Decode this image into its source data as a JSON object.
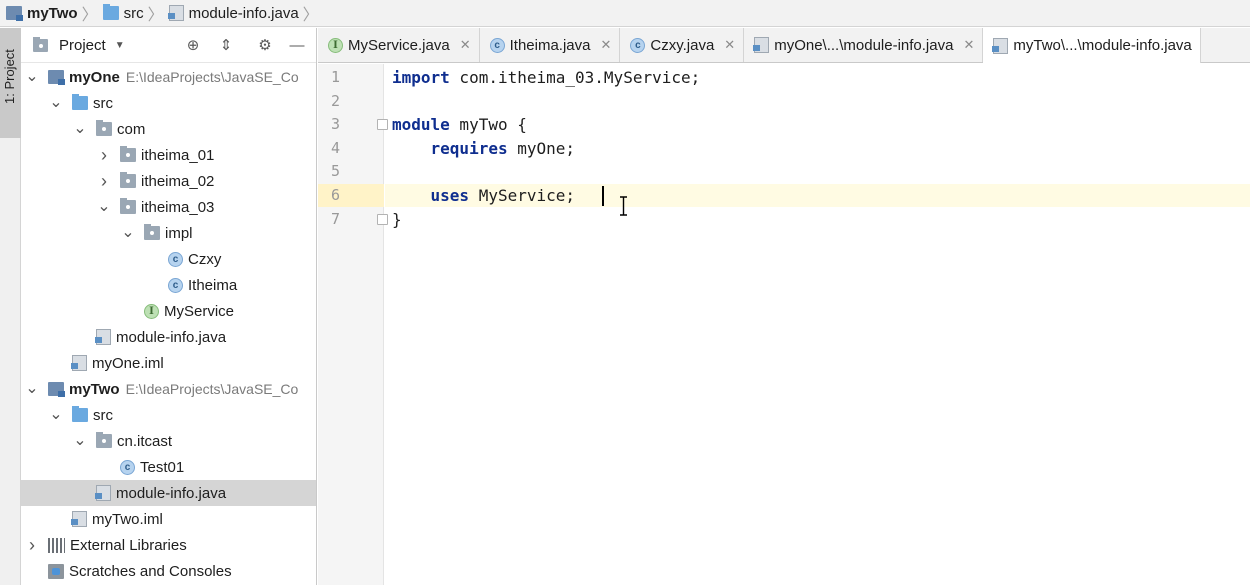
{
  "breadcrumb": {
    "items": [
      {
        "label": "myTwo",
        "icon": "module-icon"
      },
      {
        "label": "src",
        "icon": "folder-icon"
      },
      {
        "label": "module-info.java",
        "icon": "java-file-icon"
      }
    ]
  },
  "tool_stripe": {
    "project_tab_label": "1: Project"
  },
  "project_panel": {
    "title": "Project",
    "tree": [
      {
        "label": "myOne",
        "path": "E:\\IdeaProjects\\JavaSE_Co",
        "icon": "module",
        "bold": true,
        "expanded": true,
        "indent": 0
      },
      {
        "label": "src",
        "icon": "src",
        "expanded": true,
        "indent": 1
      },
      {
        "label": "com",
        "icon": "pkg",
        "expanded": true,
        "indent": 2
      },
      {
        "label": "itheima_01",
        "icon": "pkg",
        "expanded": false,
        "indent": 3
      },
      {
        "label": "itheima_02",
        "icon": "pkg",
        "expanded": false,
        "indent": 3
      },
      {
        "label": "itheima_03",
        "icon": "pkg",
        "expanded": true,
        "indent": 3
      },
      {
        "label": "impl",
        "icon": "pkg",
        "expanded": true,
        "indent": 4
      },
      {
        "label": "Czxy",
        "icon": "class",
        "indent": 5
      },
      {
        "label": "Itheima",
        "icon": "class",
        "indent": 5
      },
      {
        "label": "MyService",
        "icon": "iface",
        "indent": 4
      },
      {
        "label": "module-info.java",
        "icon": "file",
        "indent": 2
      },
      {
        "label": "myOne.iml",
        "icon": "file",
        "indent": 1
      },
      {
        "label": "myTwo",
        "path": "E:\\IdeaProjects\\JavaSE_Co",
        "icon": "module",
        "bold": true,
        "expanded": true,
        "indent": 0
      },
      {
        "label": "src",
        "icon": "src",
        "expanded": true,
        "indent": 1
      },
      {
        "label": "cn.itcast",
        "icon": "pkg",
        "expanded": true,
        "indent": 2
      },
      {
        "label": "Test01",
        "icon": "class",
        "indent": 3
      },
      {
        "label": "module-info.java",
        "icon": "file",
        "indent": 2,
        "selected": true
      },
      {
        "label": "myTwo.iml",
        "icon": "file",
        "indent": 1
      },
      {
        "label": "External Libraries",
        "icon": "libs",
        "expanded": false,
        "indent": 0
      },
      {
        "label": "Scratches and Consoles",
        "icon": "scratch",
        "indent": 0
      }
    ]
  },
  "tabs": [
    {
      "label": "MyService.java",
      "icon": "iface",
      "active": false
    },
    {
      "label": "Itheima.java",
      "icon": "class",
      "active": false
    },
    {
      "label": "Czxy.java",
      "icon": "class",
      "active": false
    },
    {
      "label": "myOne\\...\\module-info.java",
      "icon": "file",
      "active": false
    },
    {
      "label": "myTwo\\...\\module-info.java",
      "icon": "file",
      "active": true
    }
  ],
  "editor": {
    "lines": [
      {
        "num": "1",
        "tokens": [
          {
            "t": "import",
            "kw": true
          },
          {
            "t": " com.itheima_03.MyService;"
          }
        ]
      },
      {
        "num": "2",
        "tokens": []
      },
      {
        "num": "3",
        "tokens": [
          {
            "t": "module",
            "kw": true
          },
          {
            "t": " myTwo {"
          }
        ]
      },
      {
        "num": "4",
        "tokens": [
          {
            "t": "    "
          },
          {
            "t": "requires",
            "kw": true
          },
          {
            "t": " myOne;"
          }
        ]
      },
      {
        "num": "5",
        "tokens": []
      },
      {
        "num": "6",
        "tokens": [
          {
            "t": "    "
          },
          {
            "t": "uses",
            "kw": true
          },
          {
            "t": " MyService;"
          }
        ]
      },
      {
        "num": "7",
        "tokens": [
          {
            "t": "}"
          }
        ]
      }
    ],
    "current_line": "6"
  }
}
